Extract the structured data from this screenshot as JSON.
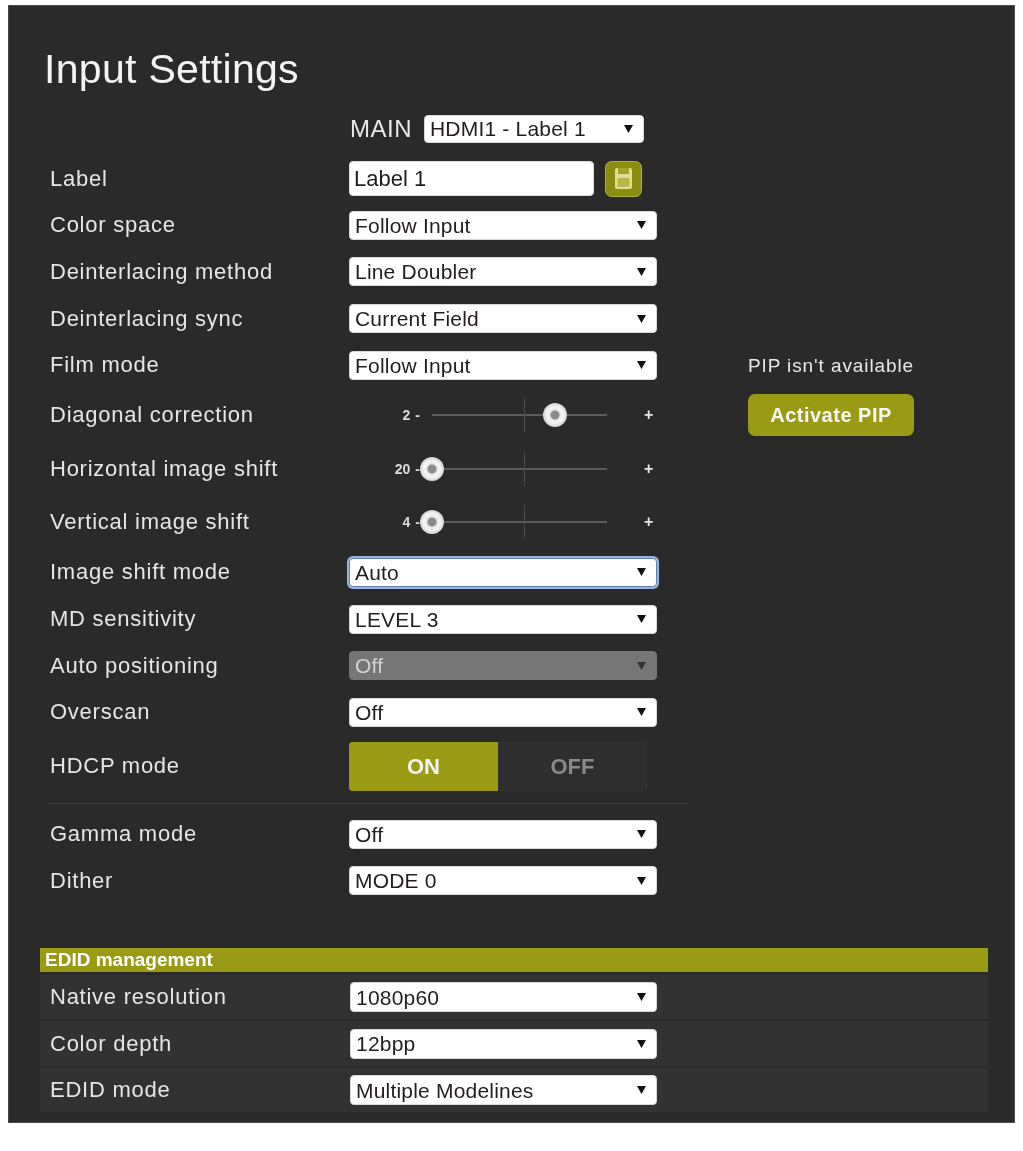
{
  "title": "Input Settings",
  "main": {
    "label": "MAIN",
    "value": "HDMI1 - Label 1"
  },
  "settings": [
    {
      "kind": "text",
      "label": "Label",
      "value": "Label 1"
    },
    {
      "kind": "select",
      "label": "Color space",
      "value": "Follow Input",
      "focused": false,
      "disabled": false
    },
    {
      "kind": "select",
      "label": "Deinterlacing method",
      "value": "Line Doubler",
      "focused": false,
      "disabled": false
    },
    {
      "kind": "select",
      "label": "Deinterlacing sync",
      "value": "Current Field",
      "focused": false,
      "disabled": false
    },
    {
      "kind": "select",
      "label": "Film mode",
      "value": "Follow Input",
      "focused": false,
      "disabled": false
    },
    {
      "kind": "slider",
      "label": "Diagonal correction",
      "reading": "2",
      "minus": "-",
      "plus": "+",
      "level": 0.7
    },
    {
      "kind": "slider",
      "label": "Horizontal image shift",
      "reading": "20",
      "minus": "-",
      "plus": "+",
      "level": 0
    },
    {
      "kind": "slider",
      "label": "Vertical image shift",
      "reading": "4",
      "minus": "-",
      "plus": "+",
      "level": 0
    },
    {
      "kind": "select",
      "label": "Image shift mode",
      "value": "Auto",
      "focused": true,
      "disabled": false
    },
    {
      "kind": "select",
      "label": "MD sensitivity",
      "value": "LEVEL 3",
      "focused": false,
      "disabled": false
    },
    {
      "kind": "select",
      "label": "Auto positioning",
      "value": "Off",
      "focused": false,
      "disabled": true
    },
    {
      "kind": "select",
      "label": "Overscan",
      "value": "Off",
      "focused": false,
      "disabled": false
    },
    {
      "kind": "toggle",
      "label": "HDCP mode",
      "options": [
        {
          "label": "ON",
          "selected": true
        },
        {
          "label": "OFF",
          "selected": false
        }
      ]
    },
    {
      "kind": "divider"
    },
    {
      "kind": "select",
      "label": "Gamma mode",
      "value": "Off",
      "focused": false,
      "disabled": false
    },
    {
      "kind": "select",
      "label": "Dither",
      "value": "MODE 0",
      "focused": false,
      "disabled": false
    }
  ],
  "pip": {
    "status": "PIP isn't available",
    "button": "Activate PIP"
  },
  "edid": {
    "title": "EDID management",
    "rows": [
      {
        "label": "Native resolution",
        "value": "1080p60"
      },
      {
        "label": "Color depth",
        "value": "12bpp"
      },
      {
        "label": "EDID mode",
        "value": "Multiple Modelines"
      }
    ]
  }
}
